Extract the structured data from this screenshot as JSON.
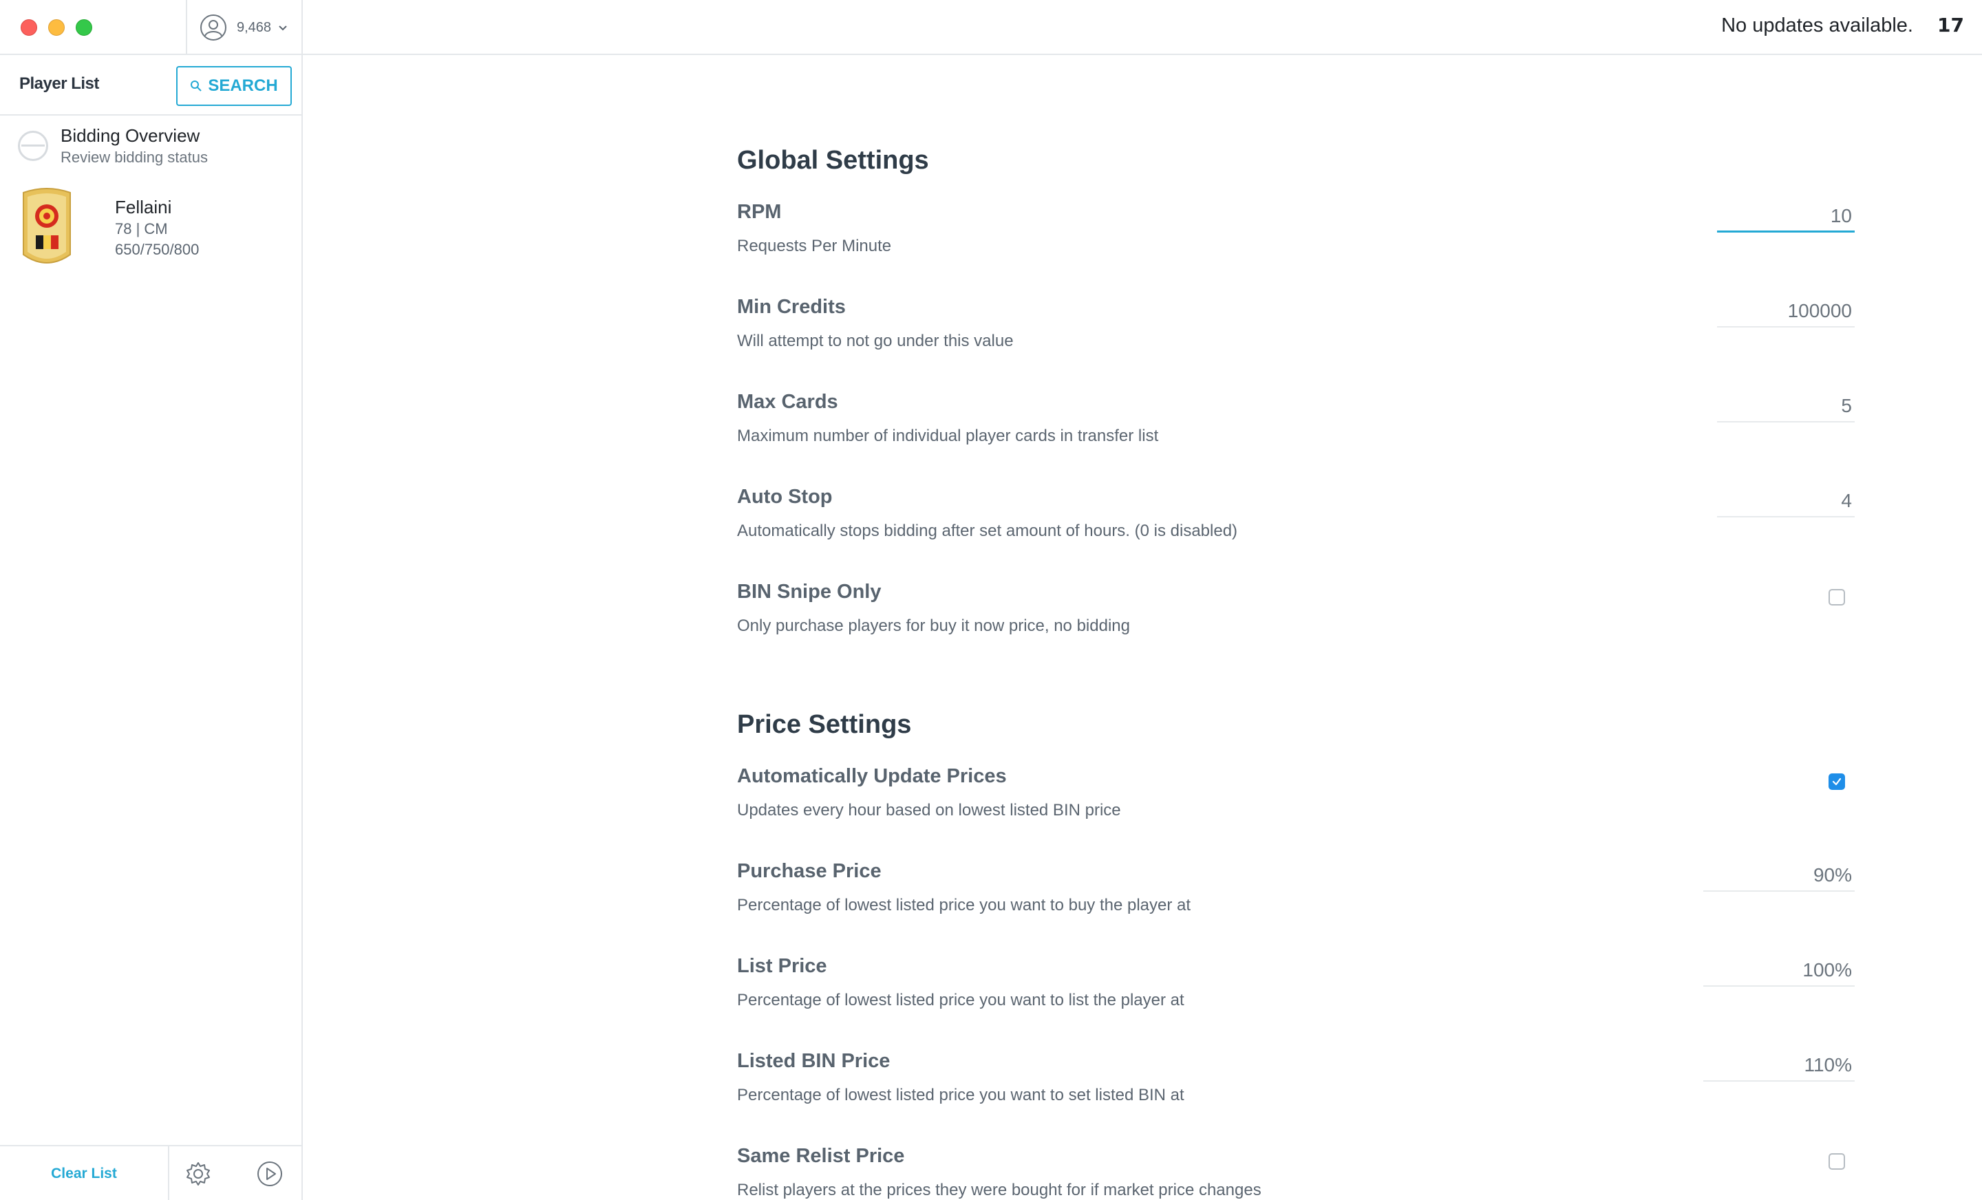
{
  "header": {
    "credits": "9,468",
    "update_status": "No updates available.",
    "version_badge": "17"
  },
  "sidebar": {
    "title": "Player List",
    "search_label": "SEARCH",
    "overview": {
      "title": "Bidding Overview",
      "subtitle": "Review bidding status"
    },
    "players": [
      {
        "name": "Fellaini",
        "rating_position": "78 | CM",
        "prices": "650/750/800"
      }
    ],
    "clear_list_label": "Clear List"
  },
  "global_settings": {
    "title": "Global Settings",
    "items": [
      {
        "label": "RPM",
        "description": "Requests Per Minute",
        "value": "10"
      },
      {
        "label": "Min Credits",
        "description": "Will attempt to not go under this value",
        "value": "100000"
      },
      {
        "label": "Max Cards",
        "description": "Maximum number of individual player cards in transfer list",
        "value": "5"
      },
      {
        "label": "Auto Stop",
        "description": "Automatically stops bidding after set amount of hours. (0 is disabled)",
        "value": "4"
      },
      {
        "label": "BIN Snipe Only",
        "description": "Only purchase players for buy it now price, no bidding",
        "checked": false
      }
    ]
  },
  "price_settings": {
    "title": "Price Settings",
    "items": [
      {
        "label": "Automatically Update Prices",
        "description": "Updates every hour based on lowest listed BIN price",
        "checked": true
      },
      {
        "label": "Purchase Price",
        "description": "Percentage of lowest listed price you want to buy the player at",
        "value": "90%"
      },
      {
        "label": "List Price",
        "description": "Percentage of lowest listed price you want to list the player at",
        "value": "100%"
      },
      {
        "label": "Listed BIN Price",
        "description": "Percentage of lowest listed price you want to set listed BIN at",
        "value": "110%"
      },
      {
        "label": "Same Relist Price",
        "description": "Relist players at the prices they were bought for if market price changes",
        "checked": false
      }
    ]
  },
  "colors": {
    "accent": "#24a9d4",
    "checkbox_checked": "#1f8ee8",
    "card_gold": "#e7c15a"
  }
}
